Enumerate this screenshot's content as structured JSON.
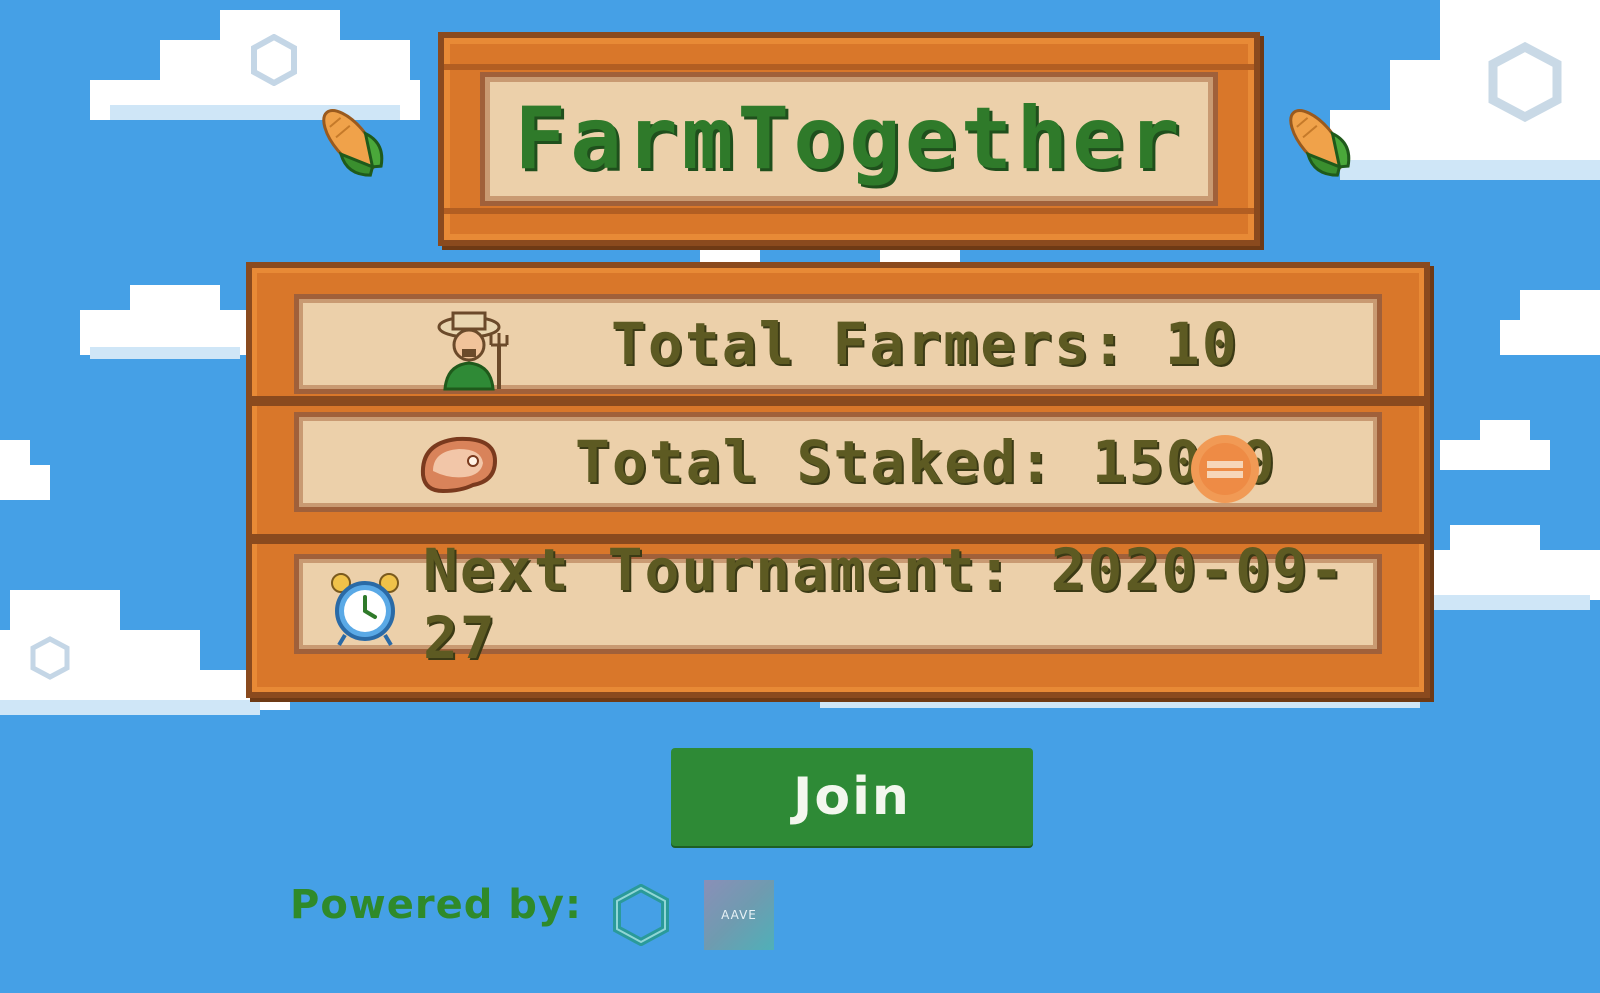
{
  "header": {
    "title": "FarmTogether"
  },
  "stats": {
    "total_farmers": "Total Farmers: 10",
    "total_staked": "Total Staked: 15000",
    "next_tournament": "Next Tournament: 2020-09-27"
  },
  "actions": {
    "join_label": "Join"
  },
  "footer": {
    "powered_by": "Powered by:",
    "aave_logo_text": "AAVE"
  },
  "icons": {
    "decor": [
      "corn-icon",
      "corn-icon"
    ],
    "stats": [
      "farmer-icon",
      "meat-icon",
      "coin-icon",
      "alarm-clock-icon"
    ],
    "footer": [
      "chainlink-logo",
      "aave-logo"
    ]
  },
  "colors": {
    "sky": "#45a0e6",
    "wood": "#d9772a",
    "wood_dark": "#8a4a1e",
    "panel": "#ecd0aa",
    "title_green": "#2f7a2a",
    "stat_text": "#5d5a22",
    "button_green": "#2e8a36"
  }
}
